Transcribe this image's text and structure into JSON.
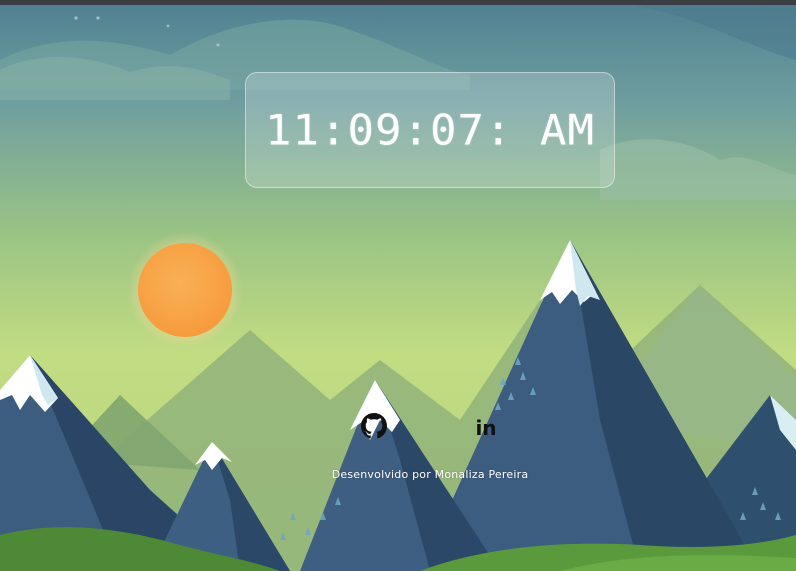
{
  "clock": {
    "time": "11:09:07: AM"
  },
  "social": {
    "github_icon": "github-icon",
    "linkedin_icon": "linkedin-icon",
    "linkedin_glyph": "in"
  },
  "footer": {
    "credit": "Desenvolvido por Monaliza Pereira"
  },
  "colors": {
    "sky_top": "#5f8f95",
    "sky_bottom": "#b8d67a",
    "sun": "#f8a944",
    "mountain_dark": "#2c4a6b",
    "mountain_mid": "#3d5f82",
    "grass": "#5d9a3c",
    "snow": "#ffffff"
  }
}
